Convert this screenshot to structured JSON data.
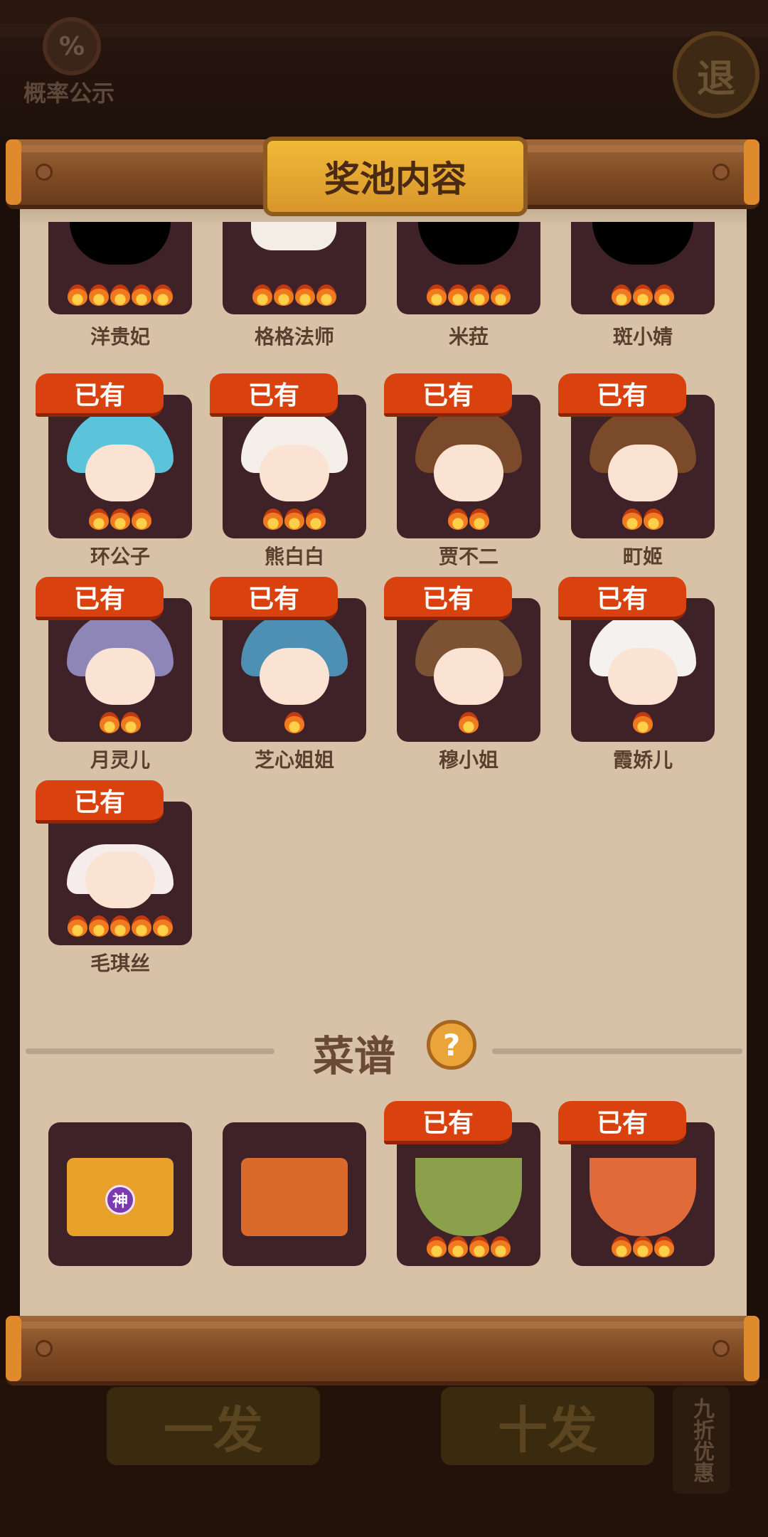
{
  "header": {
    "probability_label": "概率公示",
    "probability_icon": "%",
    "exit_label": "退"
  },
  "panel": {
    "title": "奖池内容"
  },
  "characters": [
    {
      "name": "洋贵妃",
      "owned": false,
      "stars": 5
    },
    {
      "name": "格格法师",
      "owned": false,
      "stars": 4
    },
    {
      "name": "米菈",
      "owned": false,
      "stars": 4
    },
    {
      "name": "斑小婧",
      "owned": false,
      "stars": 3
    },
    {
      "name": "环公子",
      "owned": true,
      "stars": 3
    },
    {
      "name": "熊白白",
      "owned": true,
      "stars": 3
    },
    {
      "name": "贾不二",
      "owned": true,
      "stars": 2
    },
    {
      "name": "町姬",
      "owned": true,
      "stars": 2
    },
    {
      "name": "月灵儿",
      "owned": true,
      "stars": 2
    },
    {
      "name": "芝心姐姐",
      "owned": true,
      "stars": 1
    },
    {
      "name": "穆小姐",
      "owned": true,
      "stars": 1
    },
    {
      "name": "霞娇儿",
      "owned": true,
      "stars": 1
    },
    {
      "name": "毛琪丝",
      "owned": true,
      "stars": 5
    }
  ],
  "owned_label": "已有",
  "recipes": {
    "title": "菜谱",
    "help_icon": "?",
    "items": [
      {
        "owned": false,
        "stars": 0,
        "badge": "神"
      },
      {
        "owned": false,
        "stars": 0
      },
      {
        "owned": true,
        "stars": 4
      },
      {
        "owned": true,
        "stars": 3
      }
    ]
  },
  "footer": {
    "draw_one": "一发",
    "draw_ten": "十发",
    "discount": "九折优惠"
  }
}
